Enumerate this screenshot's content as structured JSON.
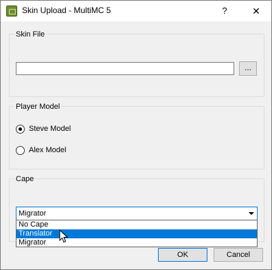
{
  "window": {
    "title": "Skin Upload - MultiMC 5",
    "help_label": "?",
    "close_label": "✕"
  },
  "skin_file": {
    "title": "Skin File",
    "value": "",
    "browse_label": "..."
  },
  "player_model": {
    "title": "Player Model",
    "options": [
      {
        "label": "Steve Model",
        "checked": true
      },
      {
        "label": "Alex Model",
        "checked": false
      }
    ]
  },
  "cape": {
    "title": "Cape",
    "selected": "Migrator",
    "options": [
      "No Cape",
      "Translator",
      "Migrator"
    ],
    "highlighted_index": 1
  },
  "buttons": {
    "ok": "OK",
    "cancel": "Cancel"
  },
  "colors": {
    "accent": "#0078d7",
    "window_bg": "#f0f0f0"
  }
}
